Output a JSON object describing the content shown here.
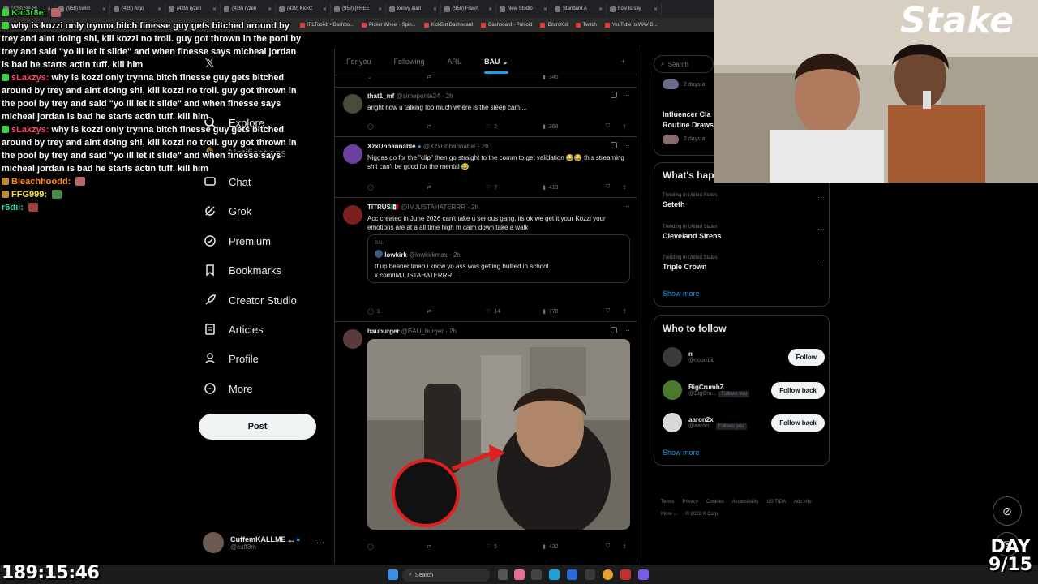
{
  "browser": {
    "tabs": [
      "(438) jae on",
      "(958) swim",
      "(439) Algo",
      "(439) ryzen",
      "(439) ryzen",
      "(439) KickC",
      "(958) [FREE",
      "konvy aunt",
      "(958) Flawn",
      "New Studio",
      "Standard A",
      "how to say"
    ],
    "bookmarks": [
      "IRLToolkit • Dashbo...",
      "Picker Wheel - Spin...",
      "KickBot Dashboard",
      "Dashboard - Pulsoid",
      "DistroKid",
      "Twitch",
      "YouTube to WAV D..."
    ]
  },
  "nav": {
    "explore": "Explore",
    "notifications": "Notifications",
    "chat": "Chat",
    "grok": "Grok",
    "premium": "Premium",
    "bookmarks": "Bookmarks",
    "creator_studio": "Creator Studio",
    "articles": "Articles",
    "profile": "Profile",
    "more": "More",
    "post_button": "Post"
  },
  "account": {
    "name": "CuffemKALLME ...",
    "handle": "@cuff3m"
  },
  "feed": {
    "tabs": [
      "For you",
      "Following",
      "ARL",
      "BAU"
    ],
    "active_tab": "BAU",
    "top_stats": {
      "views": "345"
    },
    "posts": [
      {
        "name": "that1_mf",
        "handle": "@simeponte24",
        "time": "· 2h",
        "text": "aright now u talking too much where is the sleep cam....",
        "replies": "",
        "reposts": "",
        "likes": "2",
        "views": "368"
      },
      {
        "name": "XzxUnbannable",
        "handle": "@XzxUnbannable",
        "time": "· 2h",
        "text": "Niggas go for the \"clip\" then go straight to the comm to get validation 😂😂 this streaming shit can't be good for the mental 😂",
        "replies": "",
        "reposts": "",
        "likes": "7",
        "views": "413"
      },
      {
        "name": "TITRUS🇲🇽",
        "handle": "@IMJUSTAHATERRR",
        "time": "· 2h",
        "text": "Acc created in June 2026 can't take u serious gang, its ok we get it your Kozzi your emotions are at a all time high m calm down take a walk",
        "quote_tag": "BAU",
        "quote_name": "lowkirk",
        "quote_handle": "@lowkirkmax",
        "quote_time": "· 2h",
        "quote_text": "tf up beaner lmao i know yo ass was getting bullied in school x.com/IMJUSTAHATERRR...",
        "replies": "1",
        "reposts": "",
        "likes": "14",
        "views": "778"
      },
      {
        "name": "bauburger",
        "handle": "@BAU_burger",
        "time": "· 2h",
        "replies": "",
        "reposts": "",
        "likes": "5",
        "views": "432"
      }
    ]
  },
  "sidebar": {
    "search_placeholder": "Search",
    "top_items": [
      {
        "meta": "2 days a"
      },
      {
        "title_line1": "Influencer Cla",
        "title_line2": "Routine Draws",
        "meta": "2 days a"
      }
    ],
    "trending_title": "What's hap",
    "trends": [
      {
        "meta": "Trending in United States",
        "name": "Seteth"
      },
      {
        "meta": "Trending in United States",
        "name": "Cleveland Sirens"
      },
      {
        "meta": "Trending in United States",
        "name": "Triple Crown"
      }
    ],
    "show_more": "Show more",
    "who_to_follow_title": "Who to follow",
    "who_to_follow": [
      {
        "name": "n",
        "handle": "@noorrbit",
        "follows_you": "",
        "button": "Follow"
      },
      {
        "name": "BigCrumbZ",
        "handle": "@BigCru...",
        "follows_you": "Follows you",
        "button": "Follow back"
      },
      {
        "name": "aaron2x",
        "handle": "@aaron...",
        "follows_you": "Follows you",
        "button": "Follow back"
      }
    ],
    "footer": [
      "Terms",
      "Privacy",
      "Cookies",
      "Accessibility",
      "US TIDA",
      "Ads info",
      "More ...",
      "© 2026 X Corp."
    ]
  },
  "chat": [
    {
      "user": "Kai3r8e:",
      "text": "",
      "color": "#3fd13f"
    },
    {
      "user": "",
      "text": "why is kozzi only trynna bitch finesse guy gets bitched around by trey and aint doing shi, kill kozzi no troll. guy got thrown in the pool by trey and said \"yo ill let it slide\" and when finesse says micheal jordan is bad he starts actin tuff. kill him",
      "color": "#3fd13f"
    },
    {
      "user": "sLakzys:",
      "text": "why is kozzi only trynna bitch finesse guy gets bitched around by trey and aint doing shi, kill kozzi no troll. guy got thrown in the pool by trey and said \"yo ill let it slide\" and when finesse says micheal jordan is bad he starts actin tuff. kill him",
      "color": "#ff4466"
    },
    {
      "user": "sLakzys:",
      "text": "why is kozzi only trynna bitch finesse guy gets bitched around by trey and aint doing shi, kill kozzi no troll. guy got thrown in the pool by trey and said \"yo ill let it slide\" and when finesse says micheal jordan is bad he starts actin tuff. kill him",
      "color": "#ff4466"
    },
    {
      "user": "Bleachhoodd:",
      "text": "",
      "color": "#ff8c1a"
    },
    {
      "user": "FFG999:",
      "text": "",
      "color": "#f7e33f"
    },
    {
      "user": "r6dii:",
      "text": "",
      "color": "#3fd1a0"
    }
  ],
  "overlay": {
    "timer": "189:15:46",
    "day_label": "DAY",
    "day_value": "9/15",
    "webcam_logo": "Stake"
  },
  "taskbar": {
    "search_placeholder": "Search"
  },
  "colors": {
    "accent": "#1d9bf0",
    "background": "#000000",
    "border": "#2f3336",
    "muted": "#71767b"
  }
}
